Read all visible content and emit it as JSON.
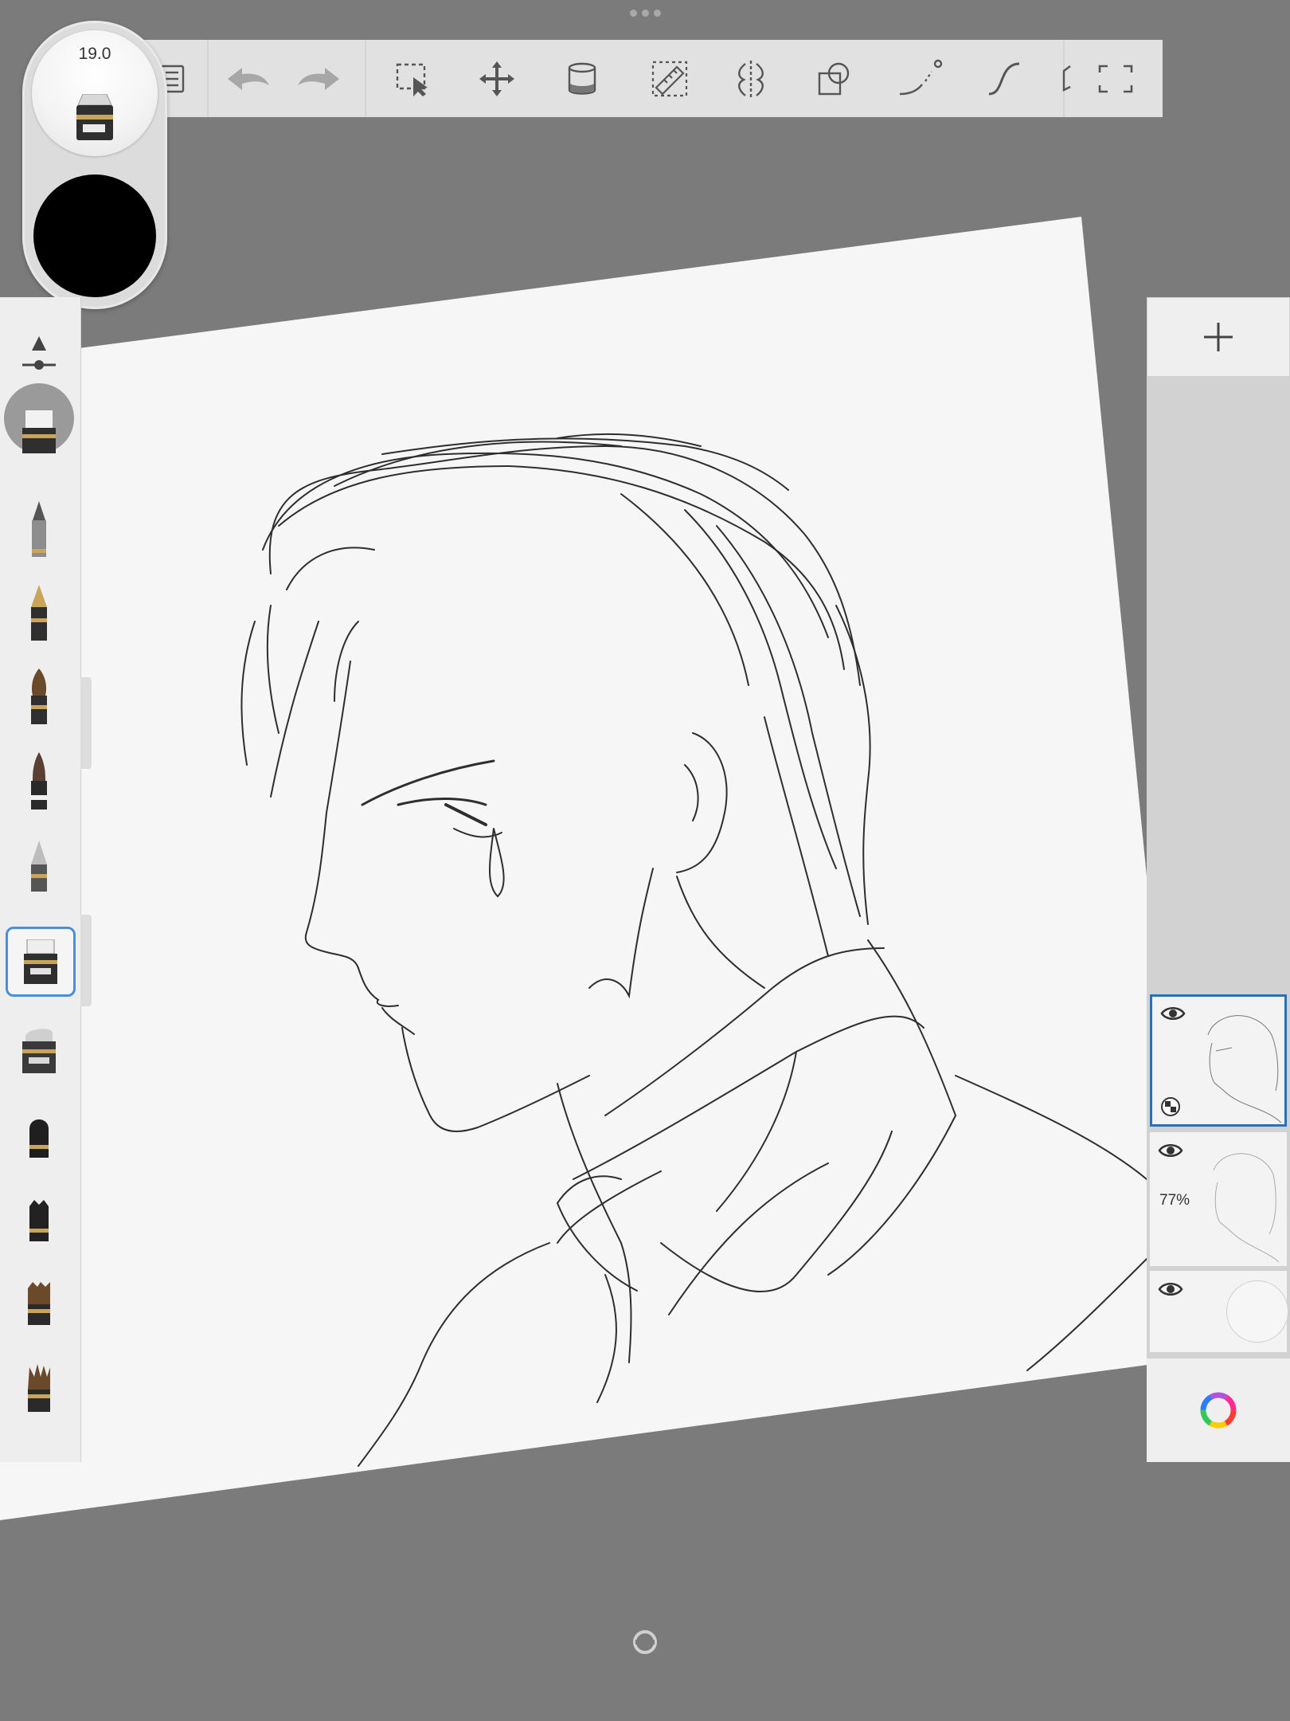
{
  "brush_puck": {
    "size_value": "19.0",
    "color": "#000000"
  },
  "toolbar": {
    "tools": [
      "menu-icon",
      "undo-icon",
      "redo-icon",
      "selection-icon",
      "transform-icon",
      "fill-icon",
      "ruler-icon",
      "symmetry-icon",
      "shape-icon",
      "predictive-stroke-icon",
      "steady-stroke-icon",
      "perspective-icon",
      "fullscreen-icon"
    ]
  },
  "layers": [
    {
      "name": "layer-1",
      "visible": true,
      "active": true,
      "opacity": ""
    },
    {
      "name": "layer-2",
      "visible": true,
      "active": false,
      "opacity": "77%"
    },
    {
      "name": "layer-3",
      "visible": true,
      "active": false,
      "opacity": ""
    }
  ],
  "colors": {
    "background": "#7b7b7b",
    "toolbar": "#e1e1e1",
    "accent": "#2a6fb9",
    "paper": "#f6f6f6"
  }
}
